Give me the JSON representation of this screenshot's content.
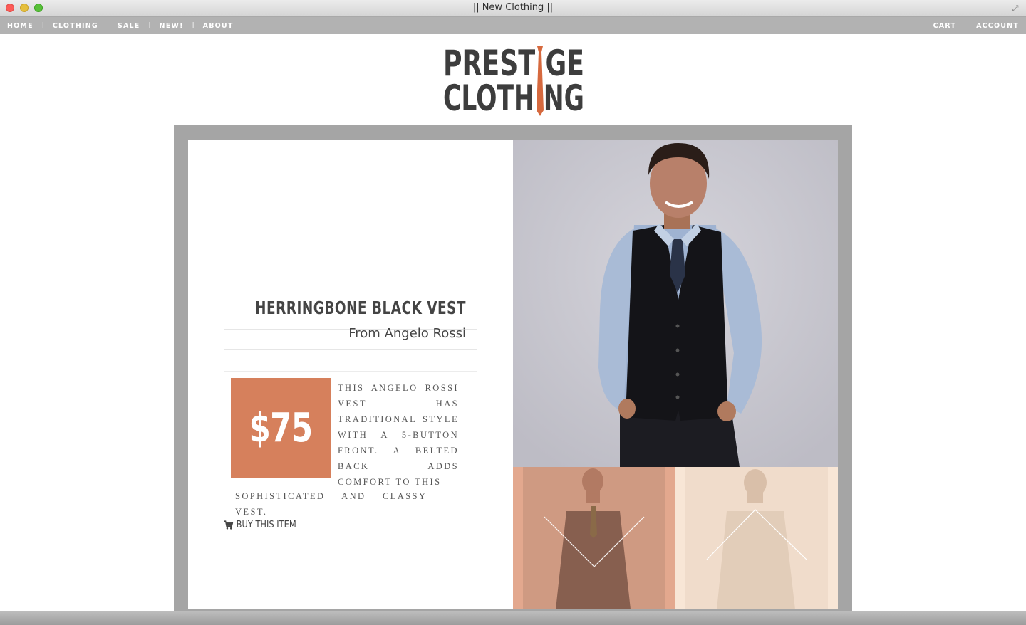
{
  "window": {
    "title": "|| New Clothing ||"
  },
  "nav": {
    "left": [
      "HOME",
      "CLOTHING",
      "SALE",
      "NEW!",
      "ABOUT"
    ],
    "right": [
      "CART",
      "ACCOUNT"
    ]
  },
  "logo": {
    "line1": "PRESTIGE",
    "line2": "CLOTHING",
    "colors": {
      "text": "#3d3d3d",
      "tie": "#d6693e"
    }
  },
  "product": {
    "title": "HERRINGBONE BLACK VEST",
    "brand": "From Angelo Rossi",
    "price": "$75",
    "description_main": "This Angelo Rossi vest has traditional style with a 5-button front. A belted back adds comfort to this",
    "description_tail": "sophisticated and classy vest.",
    "buy_label": "BUY THIS ITEM"
  },
  "colors": {
    "accent": "#d6805c",
    "frame": "#a5a5a5",
    "nav": "#b2b2b2"
  },
  "icons": {
    "buy": "cart-icon"
  }
}
